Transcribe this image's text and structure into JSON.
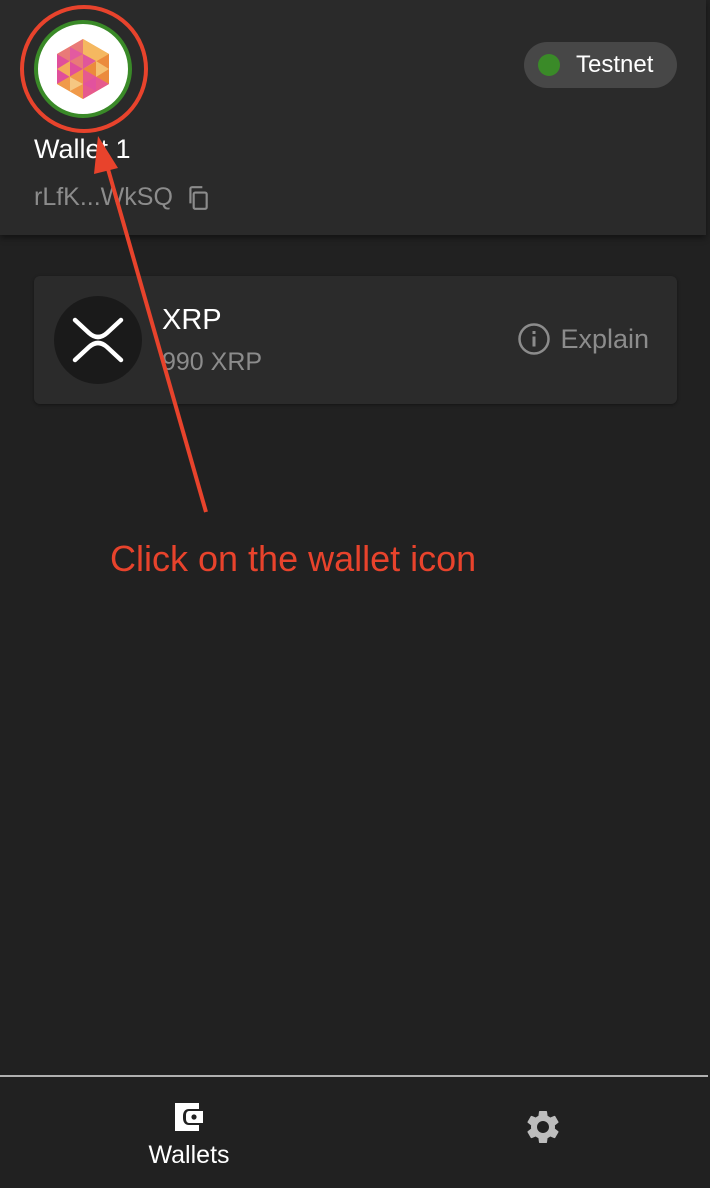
{
  "header": {
    "wallet_name": "Wallet 1",
    "address": "rLfK...WkSQ",
    "network": "Testnet",
    "network_status_color": "#3a8a28"
  },
  "tokens": [
    {
      "symbol": "XRP",
      "balance": "990 XRP",
      "action_label": "Explain",
      "icon": "xrp-logo-icon"
    }
  ],
  "annotation": {
    "text": "Click on the wallet icon",
    "color": "#e8432c"
  },
  "nav": {
    "items": [
      {
        "label": "Wallets",
        "icon": "wallet-icon",
        "active": true
      },
      {
        "label": "",
        "icon": "gear-icon",
        "active": false
      }
    ]
  },
  "colors": {
    "background": "#212121",
    "header": "#2a2a2a",
    "card": "#2b2b2b",
    "muted_text": "#8c8c8c"
  }
}
